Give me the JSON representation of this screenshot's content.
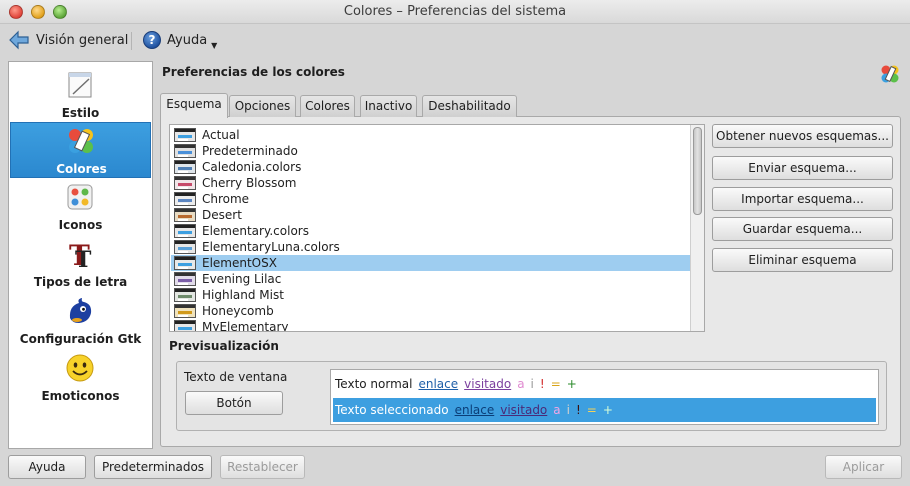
{
  "window": {
    "title": "Colores – Preferencias del sistema"
  },
  "toolbar": {
    "overview_label": "Visión general",
    "help_label": "Ayuda"
  },
  "sidebar": {
    "items": [
      {
        "label": "Estilo",
        "icon": "style-icon"
      },
      {
        "label": "Colores",
        "icon": "colors-icon",
        "selected": true
      },
      {
        "label": "Iconos",
        "icon": "icons-icon"
      },
      {
        "label": "Tipos de letra",
        "icon": "fonts-icon"
      },
      {
        "label": "Configuración Gtk",
        "icon": "gtk-icon"
      },
      {
        "label": "Emoticonos",
        "icon": "emoticons-icon"
      }
    ]
  },
  "main": {
    "title": "Preferencias de los colores",
    "tabs": [
      "Esquema",
      "Opciones",
      "Colores",
      "Inactivo",
      "Deshabilitado"
    ],
    "active_tab": "Esquema",
    "schemes": [
      "Actual",
      "Predeterminado",
      "Caledonia.colors",
      "Cherry Blossom",
      "Chrome",
      "Desert",
      "Elementary.colors",
      "ElementaryLuna.colors",
      "ElementOSX",
      "Evening Lilac",
      "Highland Mist",
      "Honeycomb",
      "MyElementary"
    ],
    "selected_scheme": "ElementOSX",
    "actions": {
      "get_new": "Obtener nuevos esquemas...",
      "send": "Enviar esquema...",
      "import": "Importar esquema...",
      "save": "Guardar esquema...",
      "remove": "Eliminar esquema"
    },
    "preview": {
      "title": "Previsualización",
      "window_text": "Texto de ventana",
      "button_label": "Botón",
      "normal_text": "Texto normal",
      "selected_text": "Texto seleccionado",
      "link": "enlace",
      "visited": "visitado",
      "markers": [
        "a",
        "i",
        "!",
        "=",
        "+"
      ]
    }
  },
  "footer": {
    "help": "Ayuda",
    "defaults": "Predeterminados",
    "reset": "Restablecer",
    "apply": "Aplicar"
  },
  "colors": {
    "selection": "#3d9fe0",
    "list_selection": "#9ecdf0",
    "link": "#1f5fa8",
    "visited": "#7b3f9e"
  }
}
